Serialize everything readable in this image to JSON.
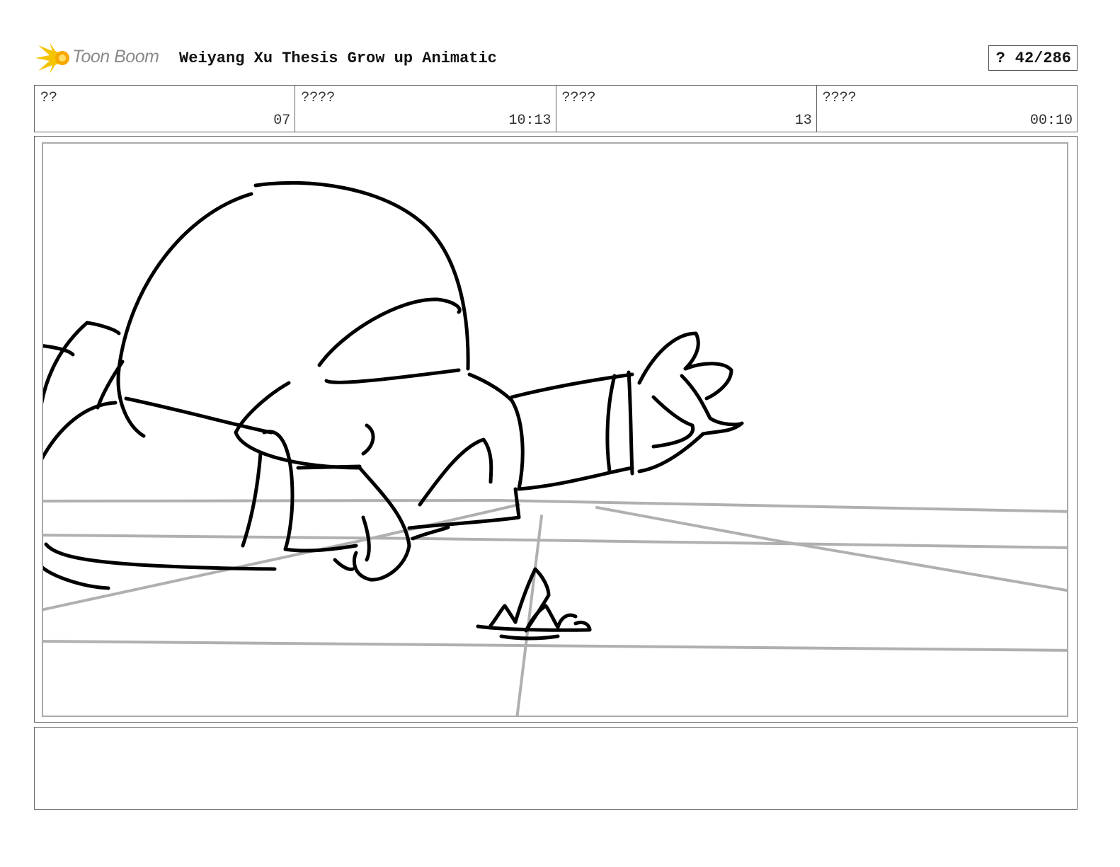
{
  "header": {
    "logo_text": "Toon Boom",
    "project_title": "Weiyang Xu Thesis Grow up Animatic",
    "page_prefix": "?",
    "page_number": "42/286"
  },
  "info_cells": [
    {
      "label": "??",
      "value": "07"
    },
    {
      "label": "????",
      "value": "10:13"
    },
    {
      "label": "????",
      "value": "13"
    },
    {
      "label": "????",
      "value": "00:10"
    }
  ],
  "notes": {
    "text": ""
  },
  "colors": {
    "logo_yellow": "#f5c400",
    "logo_text": "#8a8a8a",
    "sketch": "#000000",
    "guide_lines": "#b0b0b0"
  }
}
